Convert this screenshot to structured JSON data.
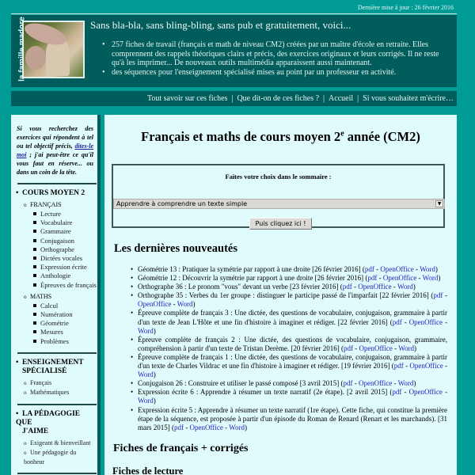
{
  "header": {
    "last_update": "Dernière mise à jour : 26 février 2016",
    "site_label": "la famille madore",
    "tagline": "Sans bla-bla, sans bling-bling, sans pub et gratuitement, voici...",
    "intro": [
      "257 fiches de travail (français et math de niveau CM2) créées par un maître d'école en retraite. Elles comprennent des rappels théoriques clairs et précis, des exercices originaux et leurs corrigés. Il ne reste qu'à les imprimer... De nouveaux outils multimédia apparaissent aussi maintenant.",
      "des séquences pour l'enseignement spécialisé mises au point par un professeur en activité."
    ]
  },
  "nav": {
    "items": [
      "Tout savoir sur ces fiches",
      "Que dit-on de ces fiches ?",
      "Accueil",
      "Si vous souhaitez m'écrire…"
    ],
    "separator": "|"
  },
  "sidebar": {
    "note_before": "Si vous recherchez des exercices qui répondent à tel ou tel objectif précis, ",
    "note_link": "dites-le moi",
    "note_after": " ; j'ai peut-être ce qu'il vous faut en réserve... ou dans un coin de la tête.",
    "sections": [
      {
        "title": "COURS MOYEN 2",
        "groups": [
          {
            "label": "FRANÇAIS",
            "items": [
              "Lecture",
              "Vocabulaire",
              "Grammaire",
              "Conjugaison",
              "Orthographe",
              "Dictées vocales",
              "Expression écrite",
              "Anthologie",
              "Épreuves de français"
            ]
          },
          {
            "label": "MATHS",
            "items": [
              "Calcul",
              "Numération",
              "Géométrie",
              "Mesures",
              "Problèmes"
            ]
          }
        ]
      },
      {
        "title_line1": "ENSEIGNEMENT",
        "title_line2": "SPÉCIALISÉ",
        "items": [
          "Français",
          "Mathématiques"
        ]
      },
      {
        "title_line1": "LA PÉDAGOGIE QUE",
        "title_line2": "J'AIME",
        "items": [
          "Exigeant & bienveillant",
          "Une pédagogie du bonheur"
        ]
      }
    ]
  },
  "main": {
    "title": "Français et maths de cours moyen 2",
    "title_sup": "e",
    "title_end": " année (CM2)",
    "form": {
      "label": "Faites votre choix dans le sommaire :",
      "selected": "Apprendre à comprendre un texte simple",
      "submit": "Puis cliquez ici !"
    },
    "news_title": "Les dernières nouveautés",
    "link_labels": {
      "pdf": "pdf",
      "oo": "OpenOffice",
      "word": "Word",
      "dash": " - "
    },
    "news": [
      "Géométrie 13 : Pratiquer la symétrie par rapport à une droite [26 février 2016] ",
      "Géométrie 12 : Découvrir la symétrie par rapport à une droite [26 février 2016] ",
      "Orthographe 36 : Le pronom \"vous\" devant un verbe [23 février 2016] ",
      "Orthographe 35 : Verbes du 1er groupe : distinguer le participe passé de l'imparfait [22 février 2016] ",
      "Épreuve complète de français 3 : Une dictée, des questions de vocabulaire, conjugaison, grammaire à partir d'un texte de Jean L'Hôte et une fin d'histoire à imaginer et rédiger. [22 février 2016] ",
      "Épreuve complète de français 2 : Une dictée, des questions de vocabulaire, conjugaison, grammaire, compréhension à partir d'un texte de Tristan Derème. [20 février 2016] ",
      "Épreuve complète de français 1 : Une dictée, des questions de vocabulaire, conjugaison, grammaire à partir d'un texte de Charles Vildrac et une fin d'histoire à imaginer et rédiger. [19 février 2016] ",
      "Conjugaison 26 : Construire et utiliser le passé composé [3 avril 2015] ",
      "Expression écrite 6 : Apprendre à résumer un texte narratif (2e étape). [2 avril 2015] ",
      "Expression écrite 5 : Apprendre à résumer un texte narratif (1re étape). Cette fiche, qui constitue la première étape de la séquence, est proposée à partir d'un épisode du Roman de Renard (Renart et les marchands). [31 mars 2015] "
    ],
    "section_title": "Fiches de français + corrigés",
    "subsection_title": "Fiches de lecture"
  }
}
